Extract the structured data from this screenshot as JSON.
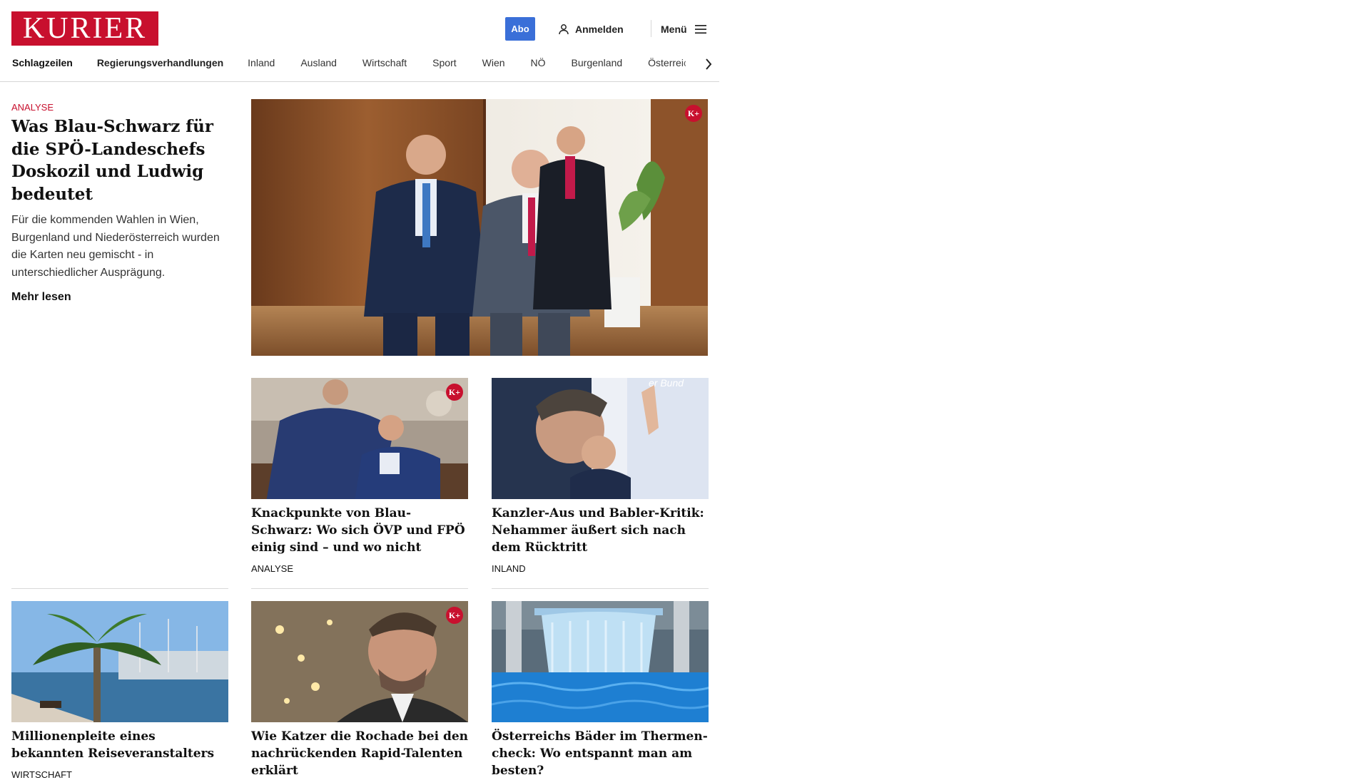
{
  "header": {
    "logo": "KURIER",
    "abo_label": "Abo",
    "login_label": "Anmelden",
    "menu_label": "Menü"
  },
  "nav": {
    "items": [
      "Schlagzeilen",
      "Regierungsverhandlungen",
      "Inland",
      "Ausland",
      "Wirtschaft",
      "Sport",
      "Wien",
      "NÖ",
      "Burgenland",
      "Österreich"
    ]
  },
  "lead": {
    "kicker": "ANALYSE",
    "title": "Was Blau-Schwarz für die SPÖ-Landeschefs Do­skozil und Ludwig bedeutet",
    "teaser": "Für die kommenden Wahlen in Wien, Burgenland und Niederösterreich wurden die Karten neu gemischt - in unterschiedlicher Ausprägung.",
    "more_label": "Mehr lesen",
    "premium_badge": "K+"
  },
  "cards": [
    {
      "title": "Knackpunkte von Blau-Schwarz: Wo sich ÖVP und FPÖ einig sind – und wo nicht",
      "section": "ANALYSE",
      "premium_badge": "K+"
    },
    {
      "title": "Kanzler-Aus und Babler-Kritik: Ne­hammer äußert sich nach dem Rücktritt",
      "section": "INLAND",
      "poster_text": "er Bund"
    },
    {
      "title": "Millionenpleite eines bekannten Reiseveranstalters",
      "section": "WIRTSCHAFT"
    },
    {
      "title": "Wie Katzer die Rochade bei den nachrückenden Rapid-Talenten erklärt",
      "premium_badge": "K+"
    },
    {
      "title": "Österreichs Bäder im Thermen-check: Wo entspannt man am besten?"
    }
  ],
  "colors": {
    "brand": "#c8102e",
    "abo": "#3a6fd8"
  }
}
